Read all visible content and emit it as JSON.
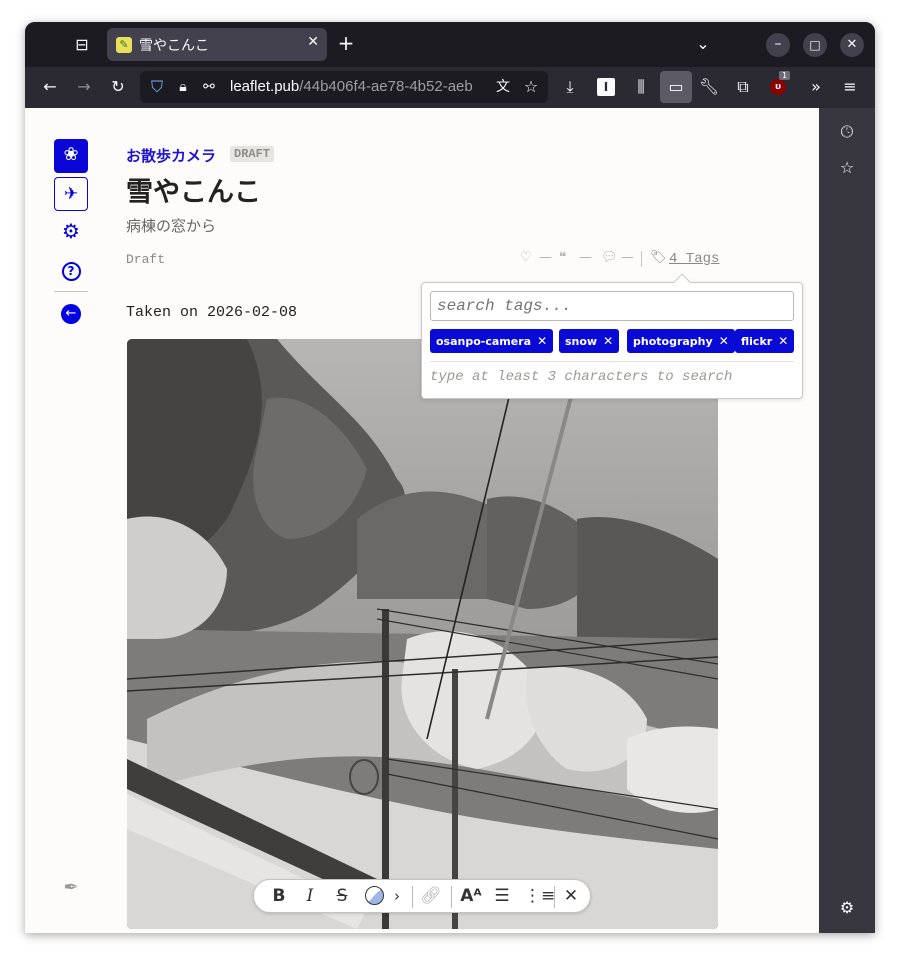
{
  "browser": {
    "tab_title": "雪やこんこ",
    "url_host": "leaflet.pub",
    "url_path": "/44b406f4-ae78-4b52-aeb"
  },
  "post": {
    "publication": "お散歩カメラ",
    "badge": "DRAFT",
    "title": "雪やこんこ",
    "subtitle": "病棟の窓から",
    "status": "Draft",
    "likes": "—",
    "quotes": "—",
    "comments": "—",
    "tags_label": "4 Tags",
    "body_text": "Taken on 2026-02-08"
  },
  "tag_popup": {
    "placeholder": "search tags...",
    "tags": [
      "osanpo-camera",
      "snow",
      "photography",
      "flickr"
    ],
    "hint": "type at least 3 characters to search"
  },
  "extension_badge": "1",
  "colors": {
    "accent": "#0b06d8",
    "tag_chip": "#0a0ad6"
  }
}
